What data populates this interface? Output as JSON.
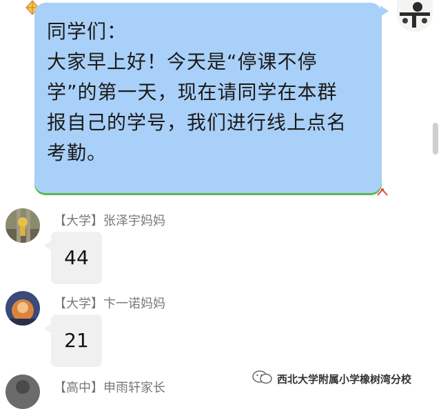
{
  "teacher_message": {
    "lines": [
      "同学们：",
      "大家早上好！今天是“停课不停",
      "学”的第一天，现在请同学在本群",
      "报自己的学号，我们进行线上点名",
      "考勤。"
    ]
  },
  "messages": [
    {
      "sender": "【大学】张泽宇妈妈",
      "content": "44"
    },
    {
      "sender": "【大学】卞一诺妈妈",
      "content": "21"
    },
    {
      "sender": "【高中】申雨轩家长",
      "content": ""
    }
  ],
  "watermark": {
    "text": "西北大学附属小学橡树湾分校"
  },
  "colors": {
    "self_bubble": "#a9d0f8",
    "self_bubble_edge": "#5ab94a",
    "incoming_bubble": "#f0f0f0",
    "sender_text": "#777777"
  },
  "icons": {
    "self_avatar": "avatar-self-icon",
    "kite": "kite-icon",
    "ribbon": "ribbon-icon",
    "wechat": "wechat-logo-icon"
  }
}
